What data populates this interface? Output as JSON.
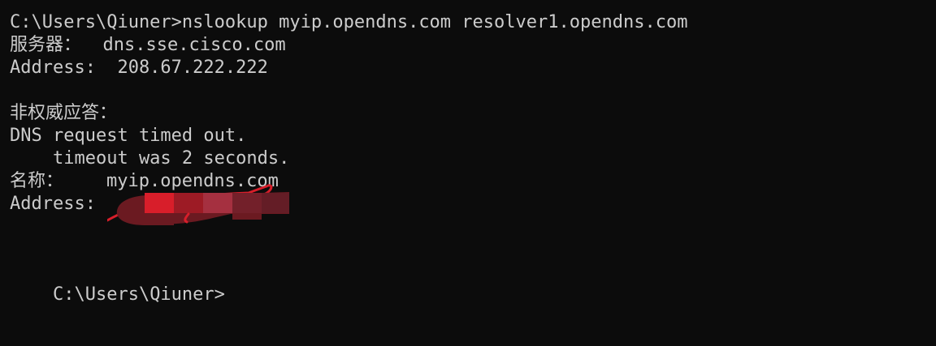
{
  "terminal": {
    "lines": [
      "C:\\Users\\Qiuner>nslookup myip.opendns.com resolver1.opendns.com",
      "服务器：  dns.sse.cisco.com",
      "Address:  208.67.222.222",
      "",
      "非权威应答：",
      "DNS request timed out.",
      "    timeout was 2 seconds.",
      "名称：    myip.opendns.com",
      "Address:",
      "",
      "",
      "C:\\Users\\Qiuner>"
    ],
    "colors": {
      "background": "#0c0c0c",
      "foreground": "#cccccc",
      "redaction_red": "#d81e2a",
      "redaction_dark": "#6b1a21"
    }
  }
}
